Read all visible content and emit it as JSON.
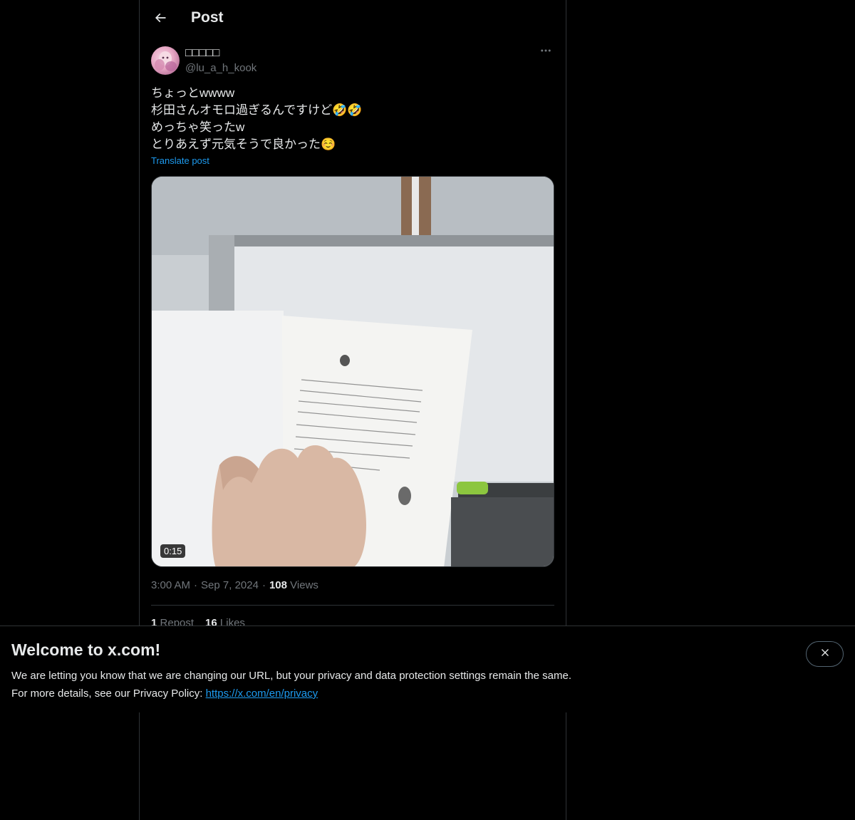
{
  "header": {
    "title": "Post",
    "back_icon": "arrow-left-icon"
  },
  "author": {
    "name": "□□□□□",
    "handle": "@lu_a_h_kook"
  },
  "post": {
    "text": "ちょっとwwww\n杉田さんオモロ過ぎるんですけど🤣🤣\nめっちゃ笑ったw\nとりあえず元気そうで良かった☺️",
    "translate_label": "Translate post"
  },
  "media": {
    "duration": "0:15"
  },
  "meta": {
    "time": "3:00 AM",
    "date": "Sep 7, 2024",
    "views_count": "108",
    "views_label": "Views"
  },
  "stats": {
    "reposts_count": "1",
    "reposts_label": "Repost",
    "likes_count": "16",
    "likes_label": "Likes"
  },
  "banner": {
    "title": "Welcome to x.com!",
    "line1": "We are letting you know that we are changing our URL, but your privacy and data protection settings remain the same.",
    "line2_prefix": "For more details, see our Privacy Policy: ",
    "link": "https://x.com/en/privacy"
  },
  "colors": {
    "background": "#000000",
    "text": "#e7e9ea",
    "muted": "#71767b",
    "accent": "#1d9bf0",
    "border": "#2f3336"
  }
}
